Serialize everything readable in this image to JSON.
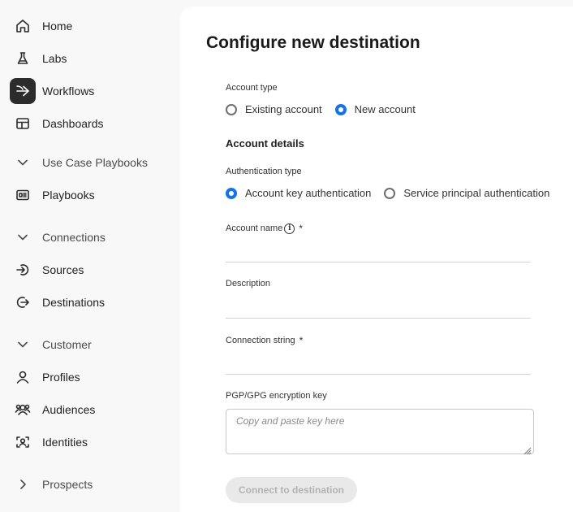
{
  "sidebar": {
    "items": [
      {
        "label": "Home",
        "icon": "home-icon"
      },
      {
        "label": "Labs",
        "icon": "flask-icon"
      },
      {
        "label": "Workflows",
        "icon": "workflow-icon",
        "active": true
      },
      {
        "label": "Dashboards",
        "icon": "dashboard-icon"
      },
      {
        "label": "Use Case Playbooks",
        "icon": "chevron-down-icon",
        "section": true
      },
      {
        "label": "Playbooks",
        "icon": "playbook-icon"
      },
      {
        "label": "Connections",
        "icon": "chevron-down-icon",
        "section": true
      },
      {
        "label": "Sources",
        "icon": "sources-icon"
      },
      {
        "label": "Destinations",
        "icon": "destinations-icon"
      },
      {
        "label": "Customer",
        "icon": "chevron-down-icon",
        "section": true
      },
      {
        "label": "Profiles",
        "icon": "profile-icon"
      },
      {
        "label": "Audiences",
        "icon": "audiences-icon"
      },
      {
        "label": "Identities",
        "icon": "identities-icon"
      },
      {
        "label": "Prospects",
        "icon": "chevron-right-icon",
        "section": true
      }
    ]
  },
  "main": {
    "title": "Configure new destination",
    "account_type": {
      "label": "Account type",
      "options": [
        "Existing account",
        "New account"
      ],
      "selected": "New account"
    },
    "account_details_title": "Account details",
    "auth_type": {
      "label": "Authentication type",
      "options": [
        "Account key authentication",
        "Service principal authentication"
      ],
      "selected": "Account key authentication"
    },
    "fields": {
      "account_name": {
        "label": "Account name",
        "required_mark": "*",
        "value": ""
      },
      "description": {
        "label": "Description",
        "value": ""
      },
      "connection_string": {
        "label": "Connection string",
        "required_mark": "*",
        "value": ""
      },
      "pgp_key": {
        "label": "PGP/GPG encryption key",
        "placeholder": "Copy and paste key here"
      }
    },
    "info_glyph": "i",
    "connect_button": "Connect to destination"
  },
  "colors": {
    "accent": "#1473e6",
    "sidebar_bg": "#f8f8f8",
    "active_nav_bg": "#2c2c2c",
    "button_disabled_bg": "#e9e9e9",
    "button_disabled_text": "#b3b3b3"
  }
}
